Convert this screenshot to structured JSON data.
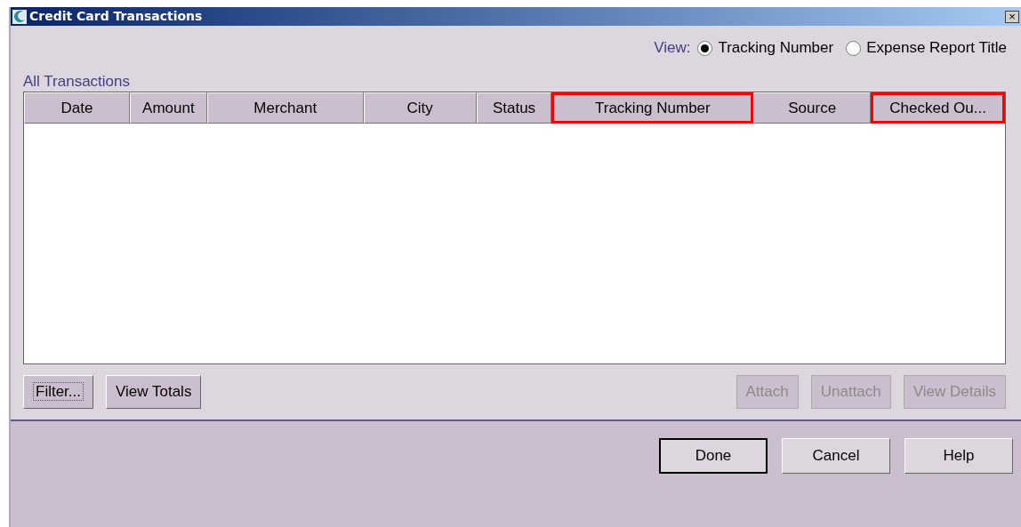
{
  "window": {
    "title": "Credit Card Transactions",
    "close": "×"
  },
  "view": {
    "label": "View:",
    "options": [
      {
        "label": "Tracking Number",
        "selected": true
      },
      {
        "label": "Expense Report Title",
        "selected": false
      }
    ]
  },
  "table": {
    "title": "All Transactions",
    "columns": [
      {
        "label": "Date",
        "highlighted": false
      },
      {
        "label": "Amount",
        "highlighted": false
      },
      {
        "label": "Merchant",
        "highlighted": false
      },
      {
        "label": "City",
        "highlighted": false
      },
      {
        "label": "Status",
        "highlighted": false
      },
      {
        "label": "Tracking Number",
        "highlighted": true
      },
      {
        "label": "Source",
        "highlighted": false
      },
      {
        "label": "Checked Ou...",
        "highlighted": true
      }
    ]
  },
  "left_buttons": [
    {
      "label": "Filter...",
      "focused": true,
      "disabled": false
    },
    {
      "label": "View Totals",
      "focused": false,
      "disabled": false
    }
  ],
  "right_buttons": [
    {
      "label": "Attach",
      "disabled": true
    },
    {
      "label": "Unattach",
      "disabled": true
    },
    {
      "label": "View Details",
      "disabled": true
    }
  ],
  "dialog_buttons": [
    {
      "label": "Done",
      "default": true
    },
    {
      "label": "Cancel",
      "default": false
    },
    {
      "label": "Help",
      "default": false
    }
  ]
}
